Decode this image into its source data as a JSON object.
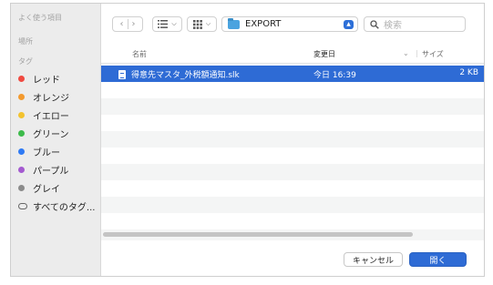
{
  "sidebar": {
    "recents_heading": "よく使う項目",
    "locations_heading": "場所",
    "tags_heading": "タグ",
    "tags": [
      {
        "label": "レッド",
        "color": "#f04a41"
      },
      {
        "label": "オレンジ",
        "color": "#f39a2e"
      },
      {
        "label": "イエロー",
        "color": "#f3c32f"
      },
      {
        "label": "グリーン",
        "color": "#3dbb4b"
      },
      {
        "label": "ブルー",
        "color": "#2f7af4"
      },
      {
        "label": "パープル",
        "color": "#a45ad0"
      },
      {
        "label": "グレイ",
        "color": "#8b8b8b"
      }
    ],
    "all_tags": "すべてのタグ..."
  },
  "toolbar": {
    "back_icon": "chevron-left-icon",
    "forward_icon": "chevron-right-icon",
    "list_view_icon": "list-view-icon",
    "grid_view_icon": "grid-view-icon",
    "folder_name": "EXPORT",
    "search_placeholder": "検索"
  },
  "list": {
    "columns": {
      "name": "名前",
      "date": "変更日",
      "size": "サイズ"
    },
    "files": [
      {
        "name": "得意先マスタ_外税額通知.slk",
        "date": "今日 16:39",
        "size": "2 KB",
        "selected": true
      }
    ]
  },
  "footer": {
    "cancel_label": "キャンセル",
    "open_label": "開く"
  },
  "colors": {
    "accent": "#2e6bd5"
  }
}
